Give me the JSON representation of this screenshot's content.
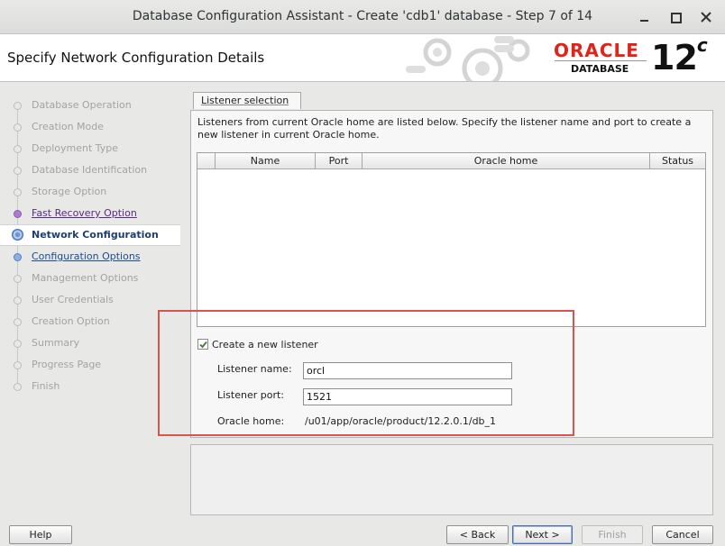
{
  "window": {
    "title": "Database Configuration Assistant - Create 'cdb1' database - Step 7 of 14"
  },
  "header": {
    "page_title": "Specify Network Configuration Details",
    "brand": "ORACLE",
    "product": "DATABASE",
    "version": "12",
    "version_suffix": "c"
  },
  "nav": {
    "items": [
      {
        "label": "Database Operation",
        "state": "disabled"
      },
      {
        "label": "Creation Mode",
        "state": "disabled"
      },
      {
        "label": "Deployment Type",
        "state": "disabled"
      },
      {
        "label": "Database Identification",
        "state": "disabled"
      },
      {
        "label": "Storage Option",
        "state": "disabled"
      },
      {
        "label": "Fast Recovery Option",
        "state": "visited"
      },
      {
        "label": "Network Configuration",
        "state": "active"
      },
      {
        "label": "Configuration Options",
        "state": "next"
      },
      {
        "label": "Management Options",
        "state": "disabled"
      },
      {
        "label": "User Credentials",
        "state": "disabled"
      },
      {
        "label": "Creation Option",
        "state": "disabled"
      },
      {
        "label": "Summary",
        "state": "disabled"
      },
      {
        "label": "Progress Page",
        "state": "disabled"
      },
      {
        "label": "Finish",
        "state": "disabled"
      }
    ]
  },
  "main": {
    "tab_label": "Listener selection",
    "intro": "Listeners from current Oracle home are listed below. Specify the listener name and port to create a new listener in current Oracle home.",
    "table": {
      "columns": [
        "",
        "Name",
        "Port",
        "Oracle home",
        "Status"
      ],
      "rows": []
    },
    "create_listener": {
      "label": "Create a new listener",
      "checked": true
    },
    "listener_name": {
      "label": "Listener name:",
      "value": "orcl"
    },
    "listener_port": {
      "label": "Listener port:",
      "value": "1521"
    },
    "oracle_home": {
      "label": "Oracle home:",
      "value": "/u01/app/oracle/product/12.2.0.1/db_1"
    }
  },
  "buttons": {
    "help": "Help",
    "back": "< Back",
    "next": "Next >",
    "finish": "Finish",
    "cancel": "Cancel"
  },
  "colors": {
    "oracle_red": "#e2231a",
    "highlight": "#d9534f",
    "nav_active": "#1d3e72",
    "nav_visited": "#5b2a84",
    "nav_next": "#1d4c8e"
  }
}
